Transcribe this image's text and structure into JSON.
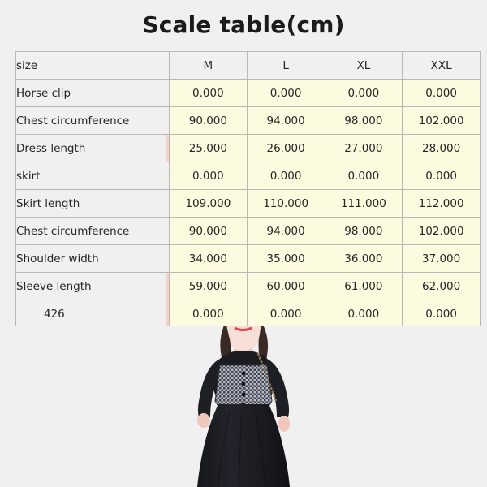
{
  "title": "Scale table(cm)",
  "table": {
    "columns": [
      "size",
      "M",
      "L",
      "XL",
      "XXL"
    ],
    "rows": [
      {
        "label": "Horse clip",
        "values": [
          "0.000",
          "0.000",
          "0.000",
          "0.000"
        ]
      },
      {
        "label": "Chest circumference",
        "values": [
          "90.000",
          "94.000",
          "98.000",
          "102.000"
        ]
      },
      {
        "label": "Dress length",
        "values": [
          "25.000",
          "26.000",
          "27.000",
          "28.000"
        ]
      },
      {
        "label": "skirt",
        "values": [
          "0.000",
          "0.000",
          "0.000",
          "0.000"
        ]
      },
      {
        "label": "Skirt length",
        "values": [
          "109.000",
          "110.000",
          "111.000",
          "112.000"
        ]
      },
      {
        "label": "Chest circumference",
        "values": [
          "90.000",
          "94.000",
          "98.000",
          "102.000"
        ]
      },
      {
        "label": "Shoulder width",
        "values": [
          "34.000",
          "35.000",
          "36.000",
          "37.000"
        ]
      },
      {
        "label": "Sleeve length",
        "values": [
          "59.000",
          "60.000",
          "61.000",
          "62.000"
        ]
      },
      {
        "label": "426",
        "values": [
          "0.000",
          "0.000",
          "0.000",
          "0.000"
        ]
      }
    ]
  },
  "photo": {
    "alt": "model-wearing-black-dress-with-houndstooth-vest",
    "colors": {
      "background": "#f0f0f0",
      "dress": "#1b1c22",
      "vest_light": "#b9bcc6",
      "vest_dark": "#41454f",
      "hair": "#3a2a26",
      "skin": "#f4d9d2",
      "lip": "#d8494f"
    }
  },
  "colors": {
    "page_background": "#f0f0f0",
    "header_cell": "#f0f0f0",
    "value_cell": "#fcfadf",
    "cell_border": "#b8b8b8",
    "marker_stripe": "#f6cfcf",
    "title_text": "#1b1b1b"
  }
}
